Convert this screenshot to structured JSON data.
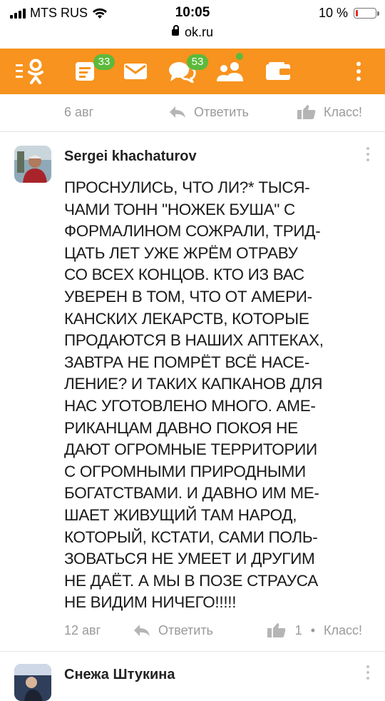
{
  "status_bar": {
    "carrier": "MTS RUS",
    "time": "10:05",
    "url": "ok.ru",
    "battery": "10 %"
  },
  "toolbar": {
    "notes_badge": "33",
    "discussions_badge": "53",
    "colors": {
      "bar": "#f7931e",
      "badge": "#5cb93c"
    }
  },
  "previous_comment": {
    "date": "6 авг",
    "reply_label": "Ответить",
    "like_label": "Класс!"
  },
  "comment": {
    "author": "Sergei khachaturov",
    "text": "ПРОСНУЛИСЬ, ЧТО ЛИ?* ТЫСЯ-\nЧАМИ ТОНН \"НОЖЕК БУША\" С\nФОРМАЛИНОМ СОЖРАЛИ, ТРИД-\nЦАТЬ ЛЕТ УЖЕ ЖРЁМ ОТРАВУ\nСО ВСЕХ КОНЦОВ. КТО ИЗ ВАС\nУВЕРЕН В ТОМ, ЧТО ОТ АМЕРИ-\nКАНСКИХ ЛЕКАРСТВ, КОТОРЫЕ\nПРОДАЮТСЯ В НАШИХ АПТЕКАХ,\nЗАВТРА НЕ ПОМРЁТ ВСЁ НАСЕ-\nЛЕНИЕ? И ТАКИХ КАПКАНОВ ДЛЯ\nНАС УГОТОВЛЕНО МНОГО. АМЕ-\nРИКАНЦАМ ДАВНО ПОКОЯ НЕ\nДАЮТ ОГРОМНЫЕ ТЕРРИТОРИИ\nС ОГРОМНЫМИ ПРИРОДНЫМИ\nБОГАТСТВАМИ. И ДАВНО ИМ МЕ-\nШАЕТ ЖИВУЩИЙ ТАМ НАРОД,\nКОТОРЫЙ, КСТАТИ, САМИ ПОЛЬ-\nЗОВАТЬСЯ НЕ УМЕЕТ И ДРУГИМ\nНЕ ДАЁТ. А МЫ В ПОЗЕ СТРАУСА\nНЕ ВИДИМ НИЧЕГО!!!!!",
    "date": "12 авг",
    "reply_label": "Ответить",
    "like_count": "1",
    "separator": "•",
    "like_label": "Класс!"
  },
  "next_comment": {
    "author": "Снежа Штукина"
  }
}
